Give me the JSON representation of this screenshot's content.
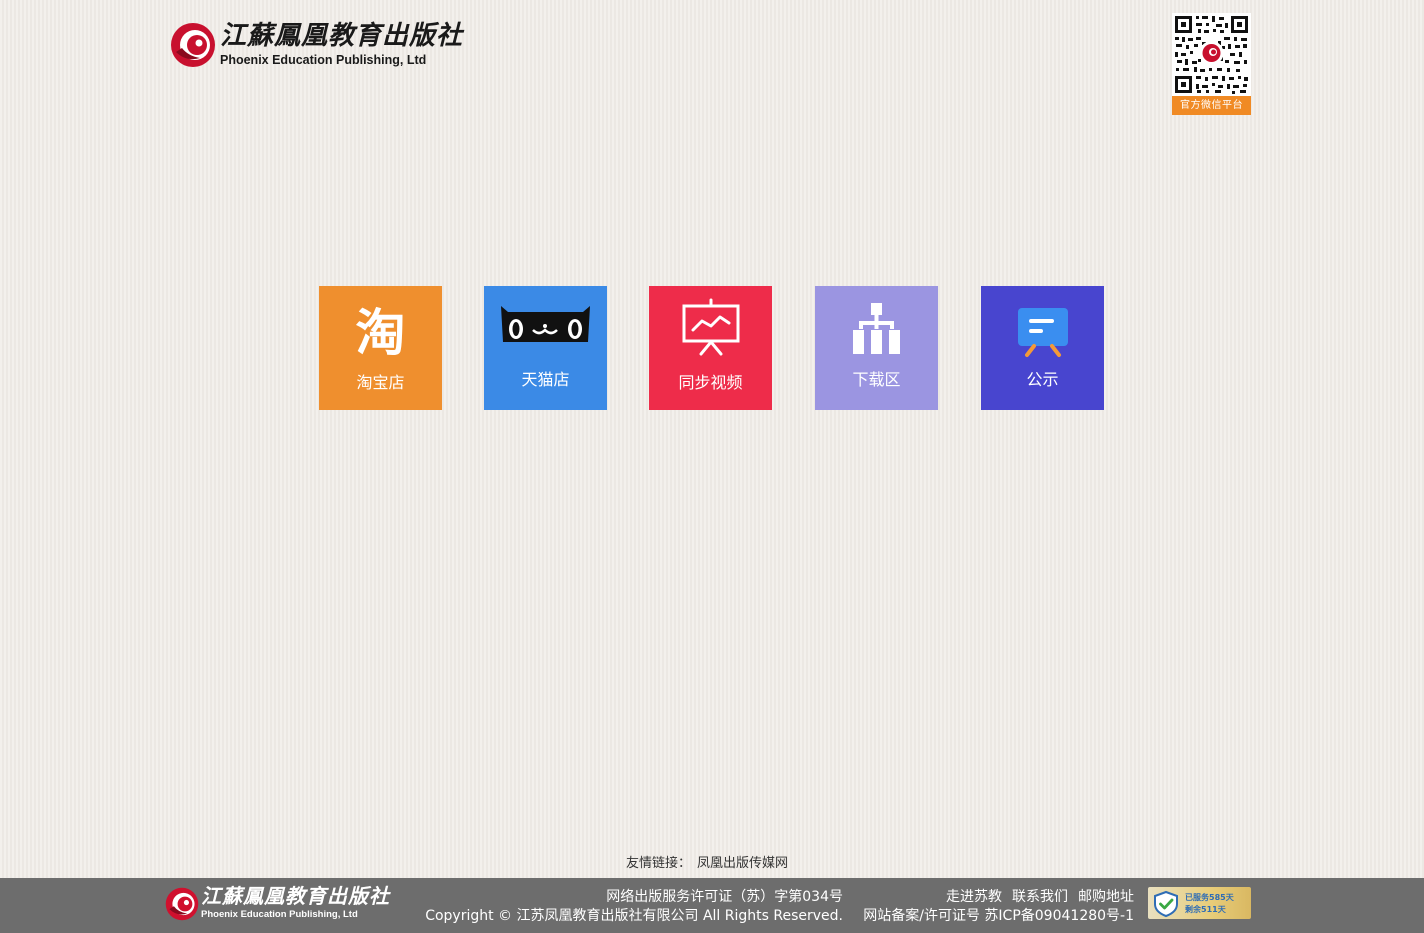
{
  "header": {
    "logo_cn": "江蘇鳳凰教育出版社",
    "logo_en": "Phoenix Education Publishing, Ltd",
    "qr_label": "官方微信平台"
  },
  "tiles": [
    {
      "label": "淘宝店",
      "icon": "taobao-icon",
      "color": "#ef8f2e"
    },
    {
      "label": "天猫店",
      "icon": "tmall-cat-icon",
      "color": "#3b8ae6"
    },
    {
      "label": "同步视频",
      "icon": "presentation-chart-icon",
      "color": "#ee2c4a"
    },
    {
      "label": "下载区",
      "icon": "hierarchy-icon",
      "color": "#9b95e1"
    },
    {
      "label": "公示",
      "icon": "notice-board-icon",
      "color": "#4845cf"
    }
  ],
  "links": {
    "label": "友情链接：",
    "items": [
      "凤凰出版传媒网"
    ]
  },
  "footer": {
    "logo_cn": "江蘇鳳凰教育出版社",
    "logo_en": "Phoenix Education Publishing, Ltd",
    "license": "网络出版服务许可证（苏）字第034号",
    "copyright": "Copyright © 江苏凤凰教育出版社有限公司 All Rights Reserved.",
    "nav": [
      "走进苏教",
      "联系我们",
      "邮购地址"
    ],
    "icp": "网站备案/许可证号 苏ICP备09041280号-1",
    "badge_line1": "已服务585天",
    "badge_line2": "剩余511天"
  }
}
